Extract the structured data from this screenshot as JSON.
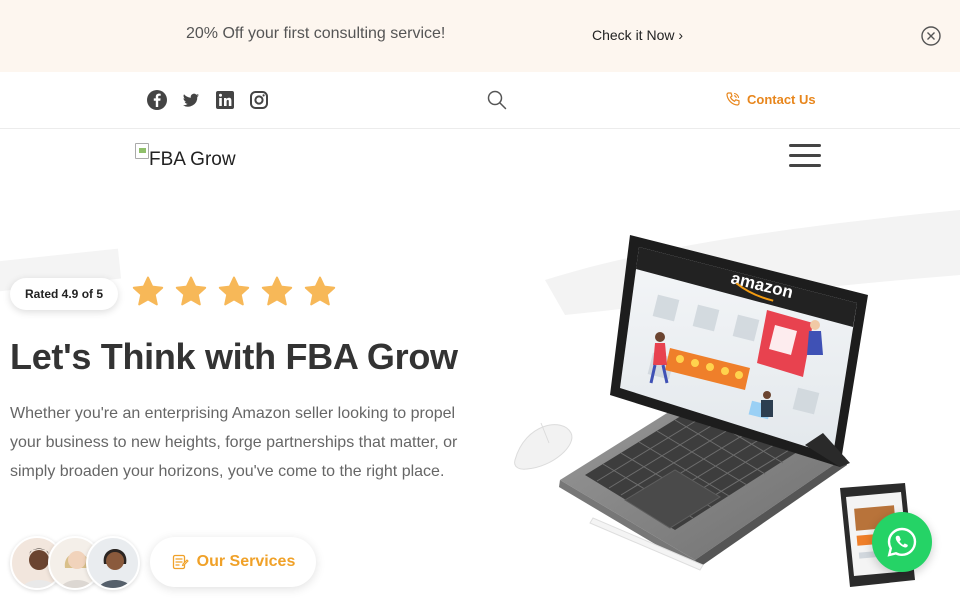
{
  "promo": {
    "text": "20% Off your first consulting service!",
    "link_label": "Check it Now ›"
  },
  "social": {
    "icons": [
      "facebook-icon",
      "twitter-icon",
      "linkedin-icon",
      "instagram-icon"
    ],
    "contact_label": "Contact Us"
  },
  "header": {
    "logo_alt": "FBA Grow"
  },
  "hero": {
    "rating_label": "Rated 4.9 of 5",
    "stars": 5,
    "headline": "Let's Think with FBA Grow",
    "description": "Whether you're an enterprising Amazon seller looking to propel your business to new heights, forge partnerships that matter, or simply broaden your horizons, you've come to the right place.",
    "services_label": "Our Services",
    "illustration_brand": "amazon"
  },
  "colors": {
    "accent": "#e8861c",
    "star": "#f7b858",
    "promo_bg": "#fdf6ef",
    "whatsapp": "#25d366"
  }
}
